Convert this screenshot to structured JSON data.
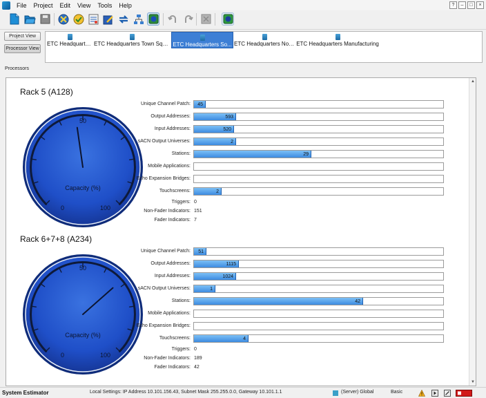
{
  "menu": [
    "File",
    "Project",
    "Edit",
    "View",
    "Tools",
    "Help"
  ],
  "window_controls": [
    "?",
    "–",
    "□",
    "×"
  ],
  "side_buttons": {
    "project_view": "Project View",
    "processor_view": "Processor View"
  },
  "tabs": [
    {
      "label": "ETC Headquarters",
      "selected": false
    },
    {
      "label": "ETC Headquarters Town Square",
      "selected": false
    },
    {
      "label": "ETC Headquarters So...",
      "selected": true
    },
    {
      "label": "ETC Headquarters North",
      "selected": false
    },
    {
      "label": "ETC Headquarters Manufacturing",
      "selected": false
    }
  ],
  "section_label": "Processors",
  "racks": [
    {
      "title": "Rack 5 (A128)",
      "capacity_percent": 47,
      "gauge": {
        "ticks": [
          "0",
          "50",
          "100"
        ],
        "label": "Capacity (%)"
      },
      "bar_metrics": [
        {
          "label": "Unique Channel Patch:",
          "value": "45",
          "fill": 0.046
        },
        {
          "label": "Output Addresses:",
          "value": "593",
          "fill": 0.17
        },
        {
          "label": "Input Addresses:",
          "value": "520",
          "fill": 0.16
        },
        {
          "label": "sACN Output Universes:",
          "value": "2",
          "fill": 0.17
        },
        {
          "label": "Stations:",
          "value": "29",
          "fill": 0.47
        },
        {
          "label": "Mobile Applications:",
          "value": "",
          "fill": 0
        },
        {
          "label": "Echo Expansion Bridges:",
          "value": "",
          "fill": 0
        },
        {
          "label": "Touchscreens:",
          "value": "2",
          "fill": 0.11
        }
      ],
      "plain_metrics": [
        {
          "label": "Triggers:",
          "value": "0"
        },
        {
          "label": "Non-Fader Indicators:",
          "value": "151"
        },
        {
          "label": "Fader Indicators:",
          "value": "7"
        }
      ]
    },
    {
      "title": "Rack 6+7+8 (A234)",
      "capacity_percent": 68,
      "gauge": {
        "ticks": [
          "0",
          "50",
          "100"
        ],
        "label": "Capacity (%)"
      },
      "bar_metrics": [
        {
          "label": "Unique Channel Patch:",
          "value": "51",
          "fill": 0.05
        },
        {
          "label": "Output Addresses:",
          "value": "1115",
          "fill": 0.18
        },
        {
          "label": "Input Addresses:",
          "value": "1024",
          "fill": 0.17
        },
        {
          "label": "sACN Output Universes:",
          "value": "1",
          "fill": 0.085
        },
        {
          "label": "Stations:",
          "value": "42",
          "fill": 0.68
        },
        {
          "label": "Mobile Applications:",
          "value": "",
          "fill": 0
        },
        {
          "label": "Echo Expansion Bridges:",
          "value": "",
          "fill": 0
        },
        {
          "label": "Touchscreens:",
          "value": "4",
          "fill": 0.22
        }
      ],
      "plain_metrics": [
        {
          "label": "Triggers:",
          "value": "0"
        },
        {
          "label": "Non-Fader Indicators:",
          "value": "189"
        },
        {
          "label": "Fader Indicators:",
          "value": "42"
        }
      ]
    }
  ],
  "status": {
    "app_name": "System Estimator",
    "local_settings": "Local Settings: IP Address 10.101.156.43, Subnet Mask 255.255.0.0, Gateway 10.101.1.1",
    "server": "(Server) Global",
    "mode": "Basic"
  },
  "colors": {
    "gauge_blue": "#1f4fc8",
    "bar_fill": "#4a95e6",
    "tab_selected": "#3d7fd5"
  }
}
